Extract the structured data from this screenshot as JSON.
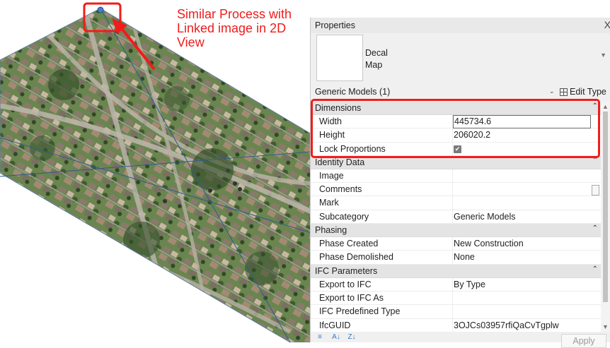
{
  "annotation": {
    "lines": [
      "Similar Process with",
      "Linked image in 2D",
      "View"
    ]
  },
  "palette": {
    "title": "Properties",
    "close_glyph": "X",
    "type_name_line1": "Decal",
    "type_name_line2": "Map",
    "filter_label": "Generic Models (1)",
    "edit_type_label": "Edit Type",
    "apply_label": "Apply",
    "sections": [
      {
        "name": "Dimensions",
        "rows": [
          {
            "k": "Width",
            "v": "445734.6",
            "kind": "input"
          },
          {
            "k": "Height",
            "v": "206020.2"
          },
          {
            "k": "Lock Proportions",
            "v": "✔",
            "kind": "checkbox"
          }
        ]
      },
      {
        "name": "Identity Data",
        "rows": [
          {
            "k": "Image",
            "v": ""
          },
          {
            "k": "Comments",
            "v": ""
          },
          {
            "k": "Mark",
            "v": ""
          },
          {
            "k": "Subcategory",
            "v": "Generic Models"
          }
        ]
      },
      {
        "name": "Phasing",
        "rows": [
          {
            "k": "Phase Created",
            "v": "New Construction"
          },
          {
            "k": "Phase Demolished",
            "v": "None"
          }
        ]
      },
      {
        "name": "IFC Parameters",
        "rows": [
          {
            "k": "Export to IFC",
            "v": "By Type"
          },
          {
            "k": "Export to IFC As",
            "v": ""
          },
          {
            "k": "IFC Predefined Type",
            "v": ""
          },
          {
            "k": "IfcGUID",
            "v": "3OJCs03957rfiQaCvTgplw"
          }
        ]
      }
    ]
  },
  "colors": {
    "annotation_red": "#f01c1c",
    "aerial_green": "#5f7d45"
  }
}
